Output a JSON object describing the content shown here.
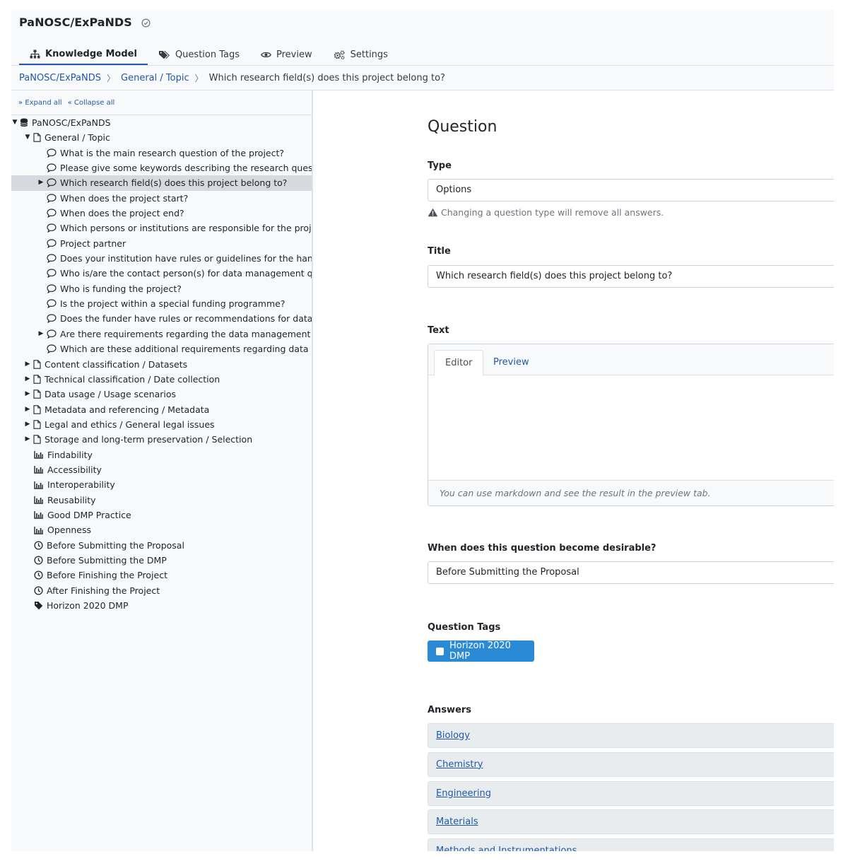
{
  "header": {
    "title": "PaNOSC/ExPaNDS",
    "tabs": [
      {
        "label": "Knowledge Model",
        "icon": "sitemap-icon"
      },
      {
        "label": "Question Tags",
        "icon": "tags-icon"
      },
      {
        "label": "Preview",
        "icon": "eye-icon"
      },
      {
        "label": "Settings",
        "icon": "cogs-icon"
      }
    ]
  },
  "breadcrumb": {
    "items": [
      "PaNOSC/ExPaNDS",
      "General / Topic"
    ],
    "current": "Which research field(s) does this project belong to?"
  },
  "tree": {
    "expand_all": "Expand all",
    "collapse_all": "Collapse all",
    "root": "PaNOSC/ExPaNDS",
    "chapter_open": "General / Topic",
    "questions": [
      "What is the main research question of the project?",
      "Please give some keywords describing the research question",
      "Which research field(s) does this project belong to?",
      "When does the project start?",
      "When does the project end?",
      "Which persons or institutions are responsible for the project",
      "Project partner",
      "Does your institution have rules or guidelines for the handlin",
      "Who is/are the contact person(s) for data management quest",
      "Who is funding the project?",
      "Is the project within a special funding programme?",
      "Does the funder have rules or recommendations for data ma",
      "Are there requirements regarding the data management fror",
      "Which are these additional requirements regarding data man"
    ],
    "chapters": [
      "Content classification / Datasets",
      "Technical classification / Date collection",
      "Data usage / Usage scenarios",
      "Metadata and referencing / Metadata",
      "Legal and ethics / General legal issues",
      "Storage and long-term preservation / Selection"
    ],
    "metrics": [
      "Findability",
      "Accessibility",
      "Interoperability",
      "Reusability",
      "Good DMP Practice",
      "Openness"
    ],
    "phases": [
      "Before Submitting the Proposal",
      "Before Submitting the DMP",
      "Before Finishing the Project",
      "After Finishing the Project"
    ],
    "tags": [
      "Horizon 2020 DMP"
    ]
  },
  "editor": {
    "heading": "Question",
    "type_label": "Type",
    "type_value": "Options",
    "type_warning": "Changing a question type will remove all answers.",
    "title_label": "Title",
    "title_value": "Which research field(s) does this project belong to?",
    "text_label": "Text",
    "text_tab_editor": "Editor",
    "text_tab_preview": "Preview",
    "text_hint": "You can use markdown and see the result in the preview tab.",
    "desirable_label": "When does this question become desirable?",
    "desirable_value": "Before Submitting the Proposal",
    "tags_label": "Question Tags",
    "tag_button": "Horizon 2020 DMP",
    "answers_label": "Answers",
    "answers": [
      "Biology",
      "Chemistry",
      "Engineering",
      "Materials",
      "Methods and Instrumentations"
    ]
  },
  "colors": {
    "link": "#1f5aa6",
    "tag_button": "#2b8ad6",
    "selected_row": "#d6dade"
  }
}
